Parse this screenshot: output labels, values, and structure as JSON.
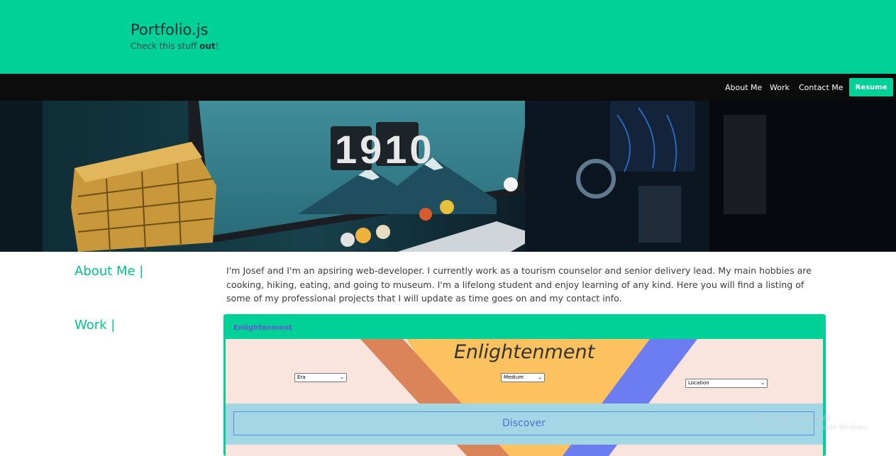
{
  "header": {
    "title": "Portfolio.js",
    "tagline_pre": "Check this stuff ",
    "tagline_bold": "out",
    "tagline_post": "!"
  },
  "nav": {
    "items": [
      "About Me",
      "Work",
      "Contact Me"
    ],
    "resume_label": "Resume"
  },
  "hero": {
    "clock_text": "1910"
  },
  "about": {
    "heading": "About Me |",
    "text": "I'm Josef and I'm an apsiring web-developer. I currently work as a tourism counselor and senior delivery lead. My main hobbies are cooking, hiking, eating, and going to museum. I'm a lifelong student and enjoy learning of any kind. Here you will find a listing of some of my professional projects that I will update as time goes on and my contact info."
  },
  "work": {
    "heading": "Work |",
    "card_title": "Enlightenment",
    "preview": {
      "title": "Enlightenment",
      "selects": [
        "Era",
        "Medium",
        "Location"
      ],
      "discover_label": "Discover"
    }
  },
  "watermark": {
    "line1": "Activate Windows",
    "line2": "Go to Settings to activate Windows."
  },
  "colors": {
    "accent": "#00d196",
    "navbar": "#0c0c0c",
    "heading": "#00c48a",
    "card_title": "#6a55d6"
  }
}
